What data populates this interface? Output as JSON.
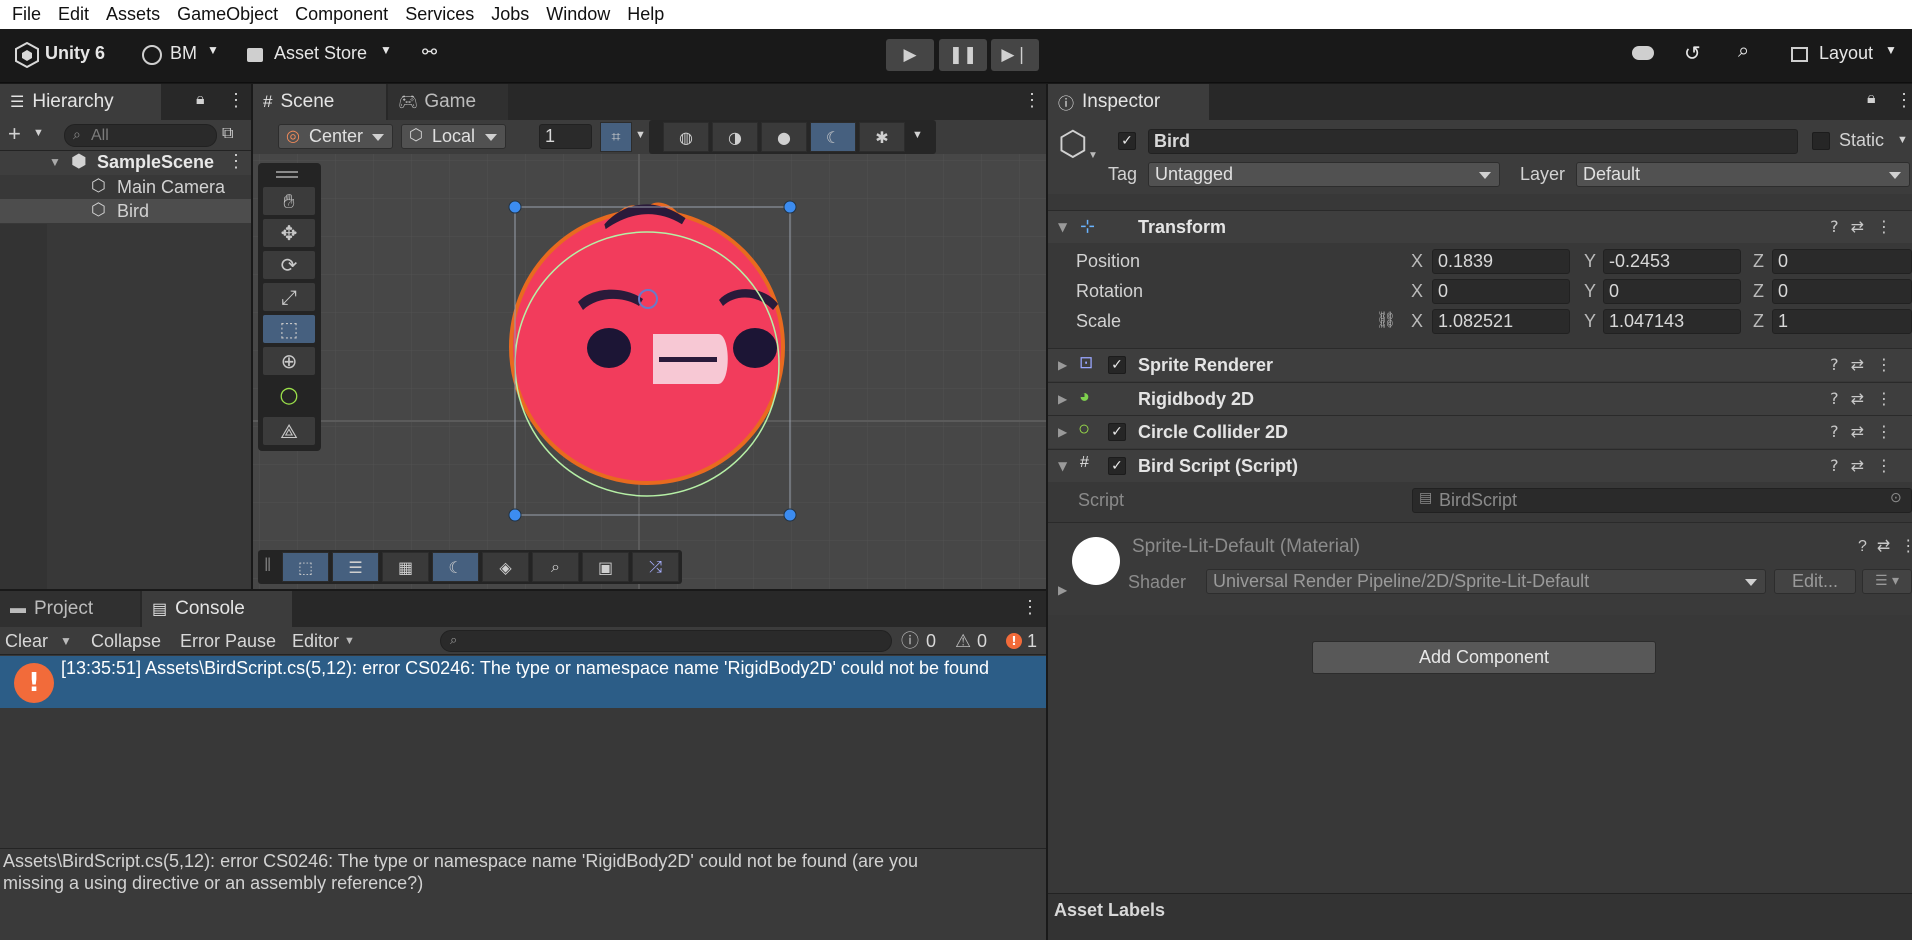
{
  "menubar": {
    "items": [
      "File",
      "Edit",
      "Assets",
      "GameObject",
      "Component",
      "Services",
      "Jobs",
      "Window",
      "Help"
    ]
  },
  "toolbar": {
    "unity_label": "Unity 6",
    "account_label": "BM",
    "asset_store_label": "Asset Store",
    "layout_label": "Layout",
    "play_icon": "play-icon",
    "pause_icon": "pause-icon",
    "step_icon": "step-icon"
  },
  "hierarchy": {
    "tab_label": "Hierarchy",
    "search_placeholder": "All",
    "scene_name": "SampleScene",
    "items": [
      "Main Camera",
      "Bird"
    ]
  },
  "scene": {
    "tabs": [
      "Scene",
      "Game"
    ],
    "pivot_label": "Center",
    "space_label": "Local",
    "grid_size": "1"
  },
  "inspector": {
    "tab_label": "Inspector",
    "object_name": "Bird",
    "static_label": "Static",
    "tag_label": "Tag",
    "tag_value": "Untagged",
    "layer_label": "Layer",
    "layer_value": "Default",
    "transform": {
      "title": "Transform",
      "position_label": "Position",
      "rotation_label": "Rotation",
      "scale_label": "Scale",
      "axes": [
        "X",
        "Y",
        "Z"
      ],
      "position": [
        "0.1839",
        "-0.2453",
        "0"
      ],
      "rotation": [
        "0",
        "0",
        "0"
      ],
      "scale": [
        "1.082521",
        "1.047143",
        "1"
      ]
    },
    "components": [
      "Sprite Renderer",
      "Rigidbody 2D",
      "Circle Collider 2D",
      "Bird Script (Script)"
    ],
    "script_label": "Script",
    "script_value": "BirdScript",
    "material_name": "Sprite-Lit-Default (Material)",
    "shader_label": "Shader",
    "shader_value": "Universal Render Pipeline/2D/Sprite-Lit-Default",
    "edit_label": "Edit...",
    "add_component_label": "Add Component",
    "asset_labels_label": "Asset Labels"
  },
  "console": {
    "tabs": [
      "Project",
      "Console"
    ],
    "clear_label": "Clear",
    "collapse_label": "Collapse",
    "error_pause_label": "Error Pause",
    "editor_label": "Editor",
    "log_count": "0",
    "warning_count": "0",
    "error_count": "1",
    "message": "[13:35:51] Assets\\BirdScript.cs(5,12): error CS0246: The type or namespace name 'RigidBody2D' could not be found",
    "detail_line1": "Assets\\BirdScript.cs(5,12): error CS0246: The type or namespace name 'RigidBody2D' could not be found (are you",
    "detail_line2": "missing a using directive or an assembly reference?)"
  },
  "colors": {
    "accent_selection": "#2c5d87",
    "error_orange": "#f26b3a",
    "bird_red": "#f23c5c",
    "panel_bg": "#383838"
  }
}
